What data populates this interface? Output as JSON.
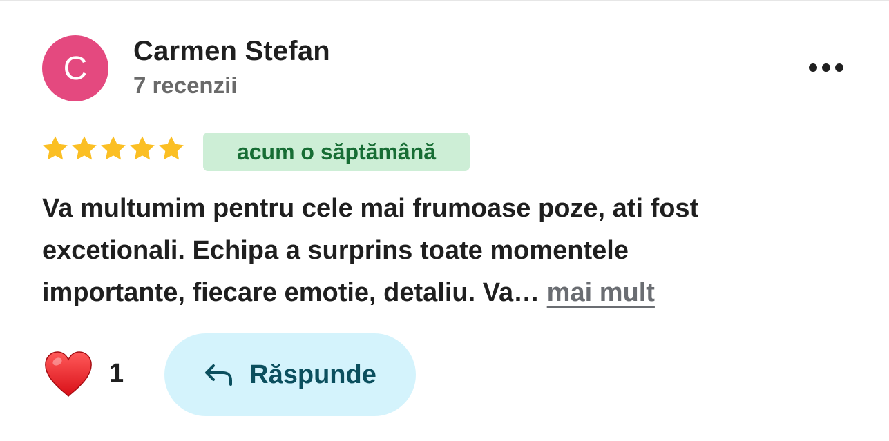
{
  "reviewer": {
    "initial": "C",
    "name": "Carmen Stefan",
    "review_count": "7 recenzii",
    "avatar_color": "#e4497f"
  },
  "menu": {
    "icon": "more-horizontal-icon"
  },
  "rating": {
    "stars": 5,
    "max_stars": 5,
    "color": "#fbbf24"
  },
  "time_ago": "acum o săptămână",
  "review": {
    "lines": [
      "Va multumim pentru cele mai frumoase poze, ati fost",
      "excetionali. Echipa a surprins toate momentele",
      "importante, fiecare emotie, detaliu. Va… "
    ],
    "more_label": "mai mult"
  },
  "reactions": {
    "icon": "heart-icon",
    "count": "1"
  },
  "reply": {
    "icon": "reply-arrow-icon",
    "label": "Răspunde"
  }
}
